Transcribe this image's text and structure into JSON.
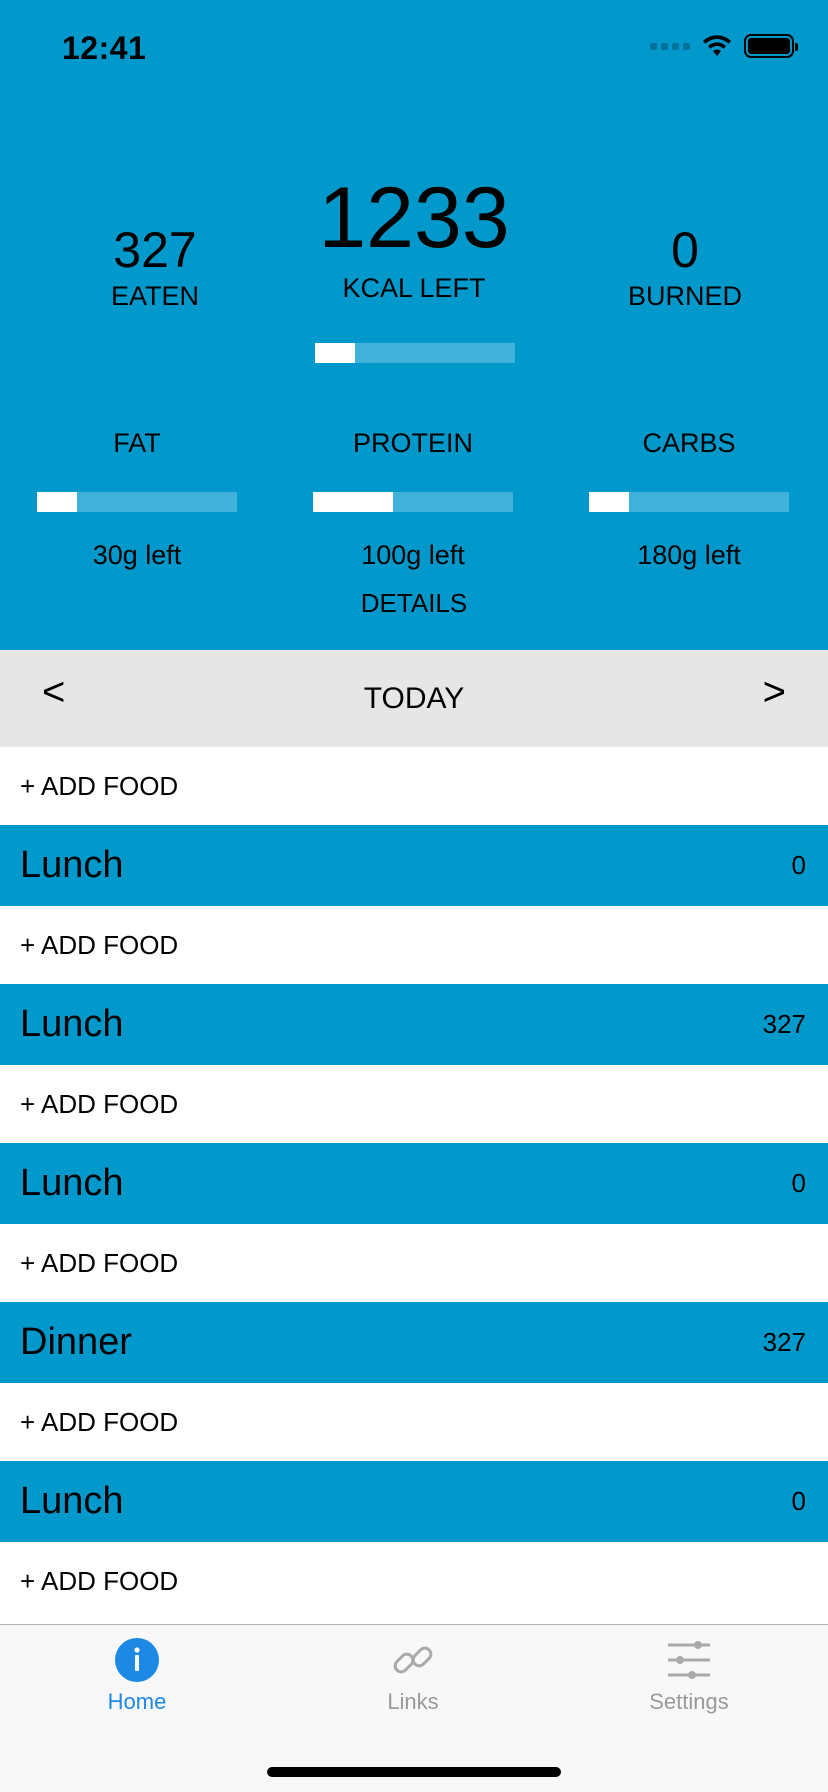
{
  "status_bar": {
    "time": "12:41"
  },
  "summary": {
    "eaten_value": "327",
    "eaten_label": "EATEN",
    "kcal_left_value": "1233",
    "kcal_left_label": "KCAL LEFT",
    "burned_value": "0",
    "burned_label": "BURNED",
    "kcal_progress": 0.2
  },
  "macros": [
    {
      "label": "FAT",
      "left_text": "30g left",
      "progress": 0.2
    },
    {
      "label": "PROTEIN",
      "left_text": "100g left",
      "progress": 0.4
    },
    {
      "label": "CARBS",
      "left_text": "180g left",
      "progress": 0.2
    }
  ],
  "details_label": "DETAILS",
  "day_nav": {
    "prev": "<",
    "day": "TODAY",
    "next": ">"
  },
  "add_food_label": "+ ADD FOOD",
  "meals": [
    {
      "name": "Lunch",
      "calories": "0"
    },
    {
      "name": "Lunch",
      "calories": "327"
    },
    {
      "name": "Lunch",
      "calories": "0"
    },
    {
      "name": "Dinner",
      "calories": "327"
    },
    {
      "name": "Lunch",
      "calories": "0"
    }
  ],
  "tabs": [
    {
      "label": "Home",
      "icon": "info-icon",
      "active": true
    },
    {
      "label": "Links",
      "icon": "link-icon",
      "active": false
    },
    {
      "label": "Settings",
      "icon": "sliders-icon",
      "active": false
    }
  ],
  "colors": {
    "accent": "#0199CC",
    "tab_active": "#1E88E5",
    "tab_inactive": "#999999",
    "nav_bg": "#E6E6E6"
  }
}
